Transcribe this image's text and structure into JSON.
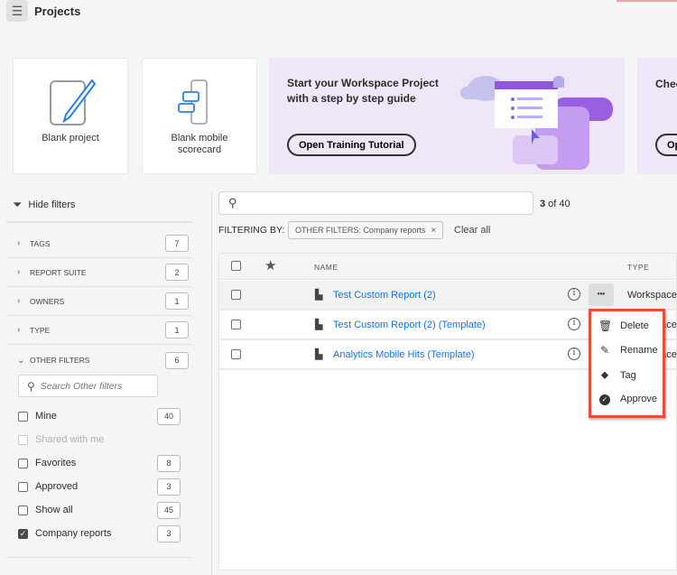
{
  "header": {
    "title": "Projects",
    "menu_icon": "hamburger-icon"
  },
  "cards": [
    {
      "label": "Blank project",
      "icon": "pencil-document-icon"
    },
    {
      "label_line1": "Blank mobile",
      "label_line2": "scorecard",
      "icon": "mobile-scorecard-icon"
    }
  ],
  "banner": {
    "title_line1": "Start your Workspace Project",
    "title_line2": "with a step by step guide",
    "button": "Open Training Tutorial"
  },
  "banner2": {
    "title": "Chec",
    "button": "Op"
  },
  "sidebar": {
    "hide_filters": "Hide filters",
    "groups": [
      {
        "label": "TAGS",
        "count": "7"
      },
      {
        "label": "REPORT SUITE",
        "count": "2"
      },
      {
        "label": "OWNERS",
        "count": "1"
      },
      {
        "label": "TYPE",
        "count": "1"
      },
      {
        "label": "OTHER FILTERS",
        "count": "6"
      }
    ],
    "search_placeholder": "Search Other filters",
    "options": [
      {
        "label": "Mine",
        "count": "40",
        "checked": false
      },
      {
        "label": "Shared with me",
        "count": "",
        "checked": false,
        "disabled": true
      },
      {
        "label": "Favorites",
        "count": "8",
        "checked": false
      },
      {
        "label": "Approved",
        "count": "3",
        "checked": false
      },
      {
        "label": "Show all",
        "count": "45",
        "checked": false
      },
      {
        "label": "Company reports",
        "count": "3",
        "checked": true
      }
    ]
  },
  "main": {
    "result_count": "3",
    "result_of": " of 40",
    "filtering_by": "FILTERING BY:",
    "filter_chip": "OTHER FILTERS: Company reports",
    "clear_all": "Clear all",
    "columns": {
      "name": "NAME",
      "type": "TYPE"
    },
    "rows": [
      {
        "name": "Test Custom Report (2)",
        "type": "Workspace p"
      },
      {
        "name": "Test Custom Report (2) (Template)",
        "type": "Workspace p"
      },
      {
        "name": "Analytics Mobile Hits (Template)",
        "type": "Workspace p"
      }
    ],
    "more_button": "•••"
  },
  "context_menu": {
    "items": [
      {
        "label": "Delete",
        "icon": "trash-icon"
      },
      {
        "label": "Rename",
        "icon": "pencil-icon"
      },
      {
        "label": "Tag",
        "icon": "tag-icon"
      },
      {
        "label": "Approve",
        "icon": "checkmark-circle-icon"
      }
    ],
    "highlight_color": "#f04a3e"
  },
  "colors": {
    "link": "#1473e6",
    "banner": "#efe7f8",
    "accent_purple": "#9256d9"
  }
}
